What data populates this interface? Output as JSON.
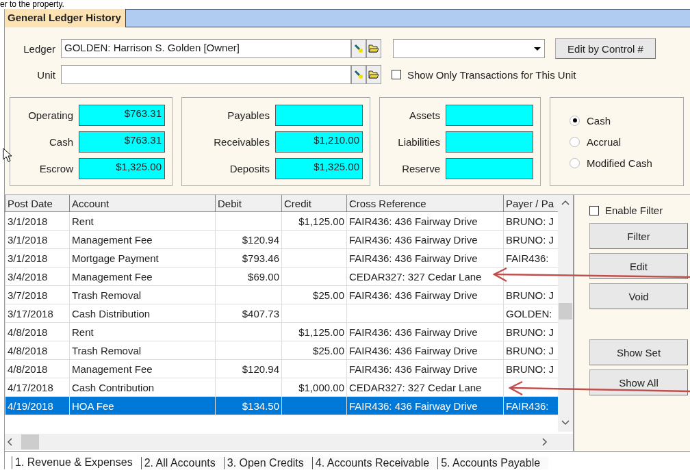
{
  "page_fragment": "er to the property.",
  "window": {
    "title": "General Ledger History"
  },
  "ledger": {
    "label": "Ledger",
    "value": "GOLDEN: Harrison S. Golden [Owner]"
  },
  "unit": {
    "label": "Unit"
  },
  "edit_by_control_button": "Edit by Control #",
  "unit_only_checkbox": {
    "label": "Show Only Transactions for This Unit",
    "checked": false
  },
  "balance_groups": [
    {
      "fields": [
        {
          "label": "Operating",
          "value": "$763.31"
        },
        {
          "label": "Cash",
          "value": "$763.31"
        },
        {
          "label": "Escrow",
          "value": "$1,325.00"
        }
      ]
    },
    {
      "fields": [
        {
          "label": "Payables"
        },
        {
          "label": "Receivables",
          "value": "$1,210.00"
        },
        {
          "label": "Deposits",
          "value": "$1,325.00"
        }
      ]
    },
    {
      "fields": [
        {
          "label": "Assets"
        },
        {
          "label": "Liabilities"
        },
        {
          "label": "Reserve"
        }
      ]
    }
  ],
  "basis_options": [
    {
      "label": "Cash",
      "selected": true
    },
    {
      "label": "Accrual",
      "selected": false
    },
    {
      "label": "Modified Cash",
      "selected": false
    }
  ],
  "table": {
    "columns": [
      "Post Date",
      "Account",
      "Debit",
      "Credit",
      "Cross Reference",
      "Payer / Pa"
    ],
    "rows": [
      {
        "post_date": "3/1/2018",
        "account": "Rent",
        "credit": "$1,125.00",
        "cross_reference": "FAIR436: 436 Fairway Drive",
        "payer": "BRUNO: J",
        "selected": false
      },
      {
        "post_date": "3/1/2018",
        "account": "Management Fee",
        "debit": "$120.94",
        "cross_reference": "FAIR436: 436 Fairway Drive",
        "payer": "BRUNO: J",
        "selected": false
      },
      {
        "post_date": "3/1/2018",
        "account": "Mortgage Payment",
        "debit": "$793.46",
        "cross_reference": "FAIR436: 436 Fairway Drive",
        "payer": "FAIR436:",
        "selected": false
      },
      {
        "post_date": "3/4/2018",
        "account": "Management Fee",
        "debit": "$69.00",
        "cross_reference": "CEDAR327: 327 Cedar Lane",
        "selected": false
      },
      {
        "post_date": "3/7/2018",
        "account": "Trash Removal",
        "credit": "$25.00",
        "cross_reference": "FAIR436: 436 Fairway Drive",
        "payer": "BRUNO: J",
        "selected": false
      },
      {
        "post_date": "3/17/2018",
        "account": "Cash Distribution",
        "debit": "$407.73",
        "payer": "GOLDEN:",
        "selected": false
      },
      {
        "post_date": "4/8/2018",
        "account": "Rent",
        "credit": "$1,125.00",
        "cross_reference": "FAIR436: 436 Fairway Drive",
        "payer": "BRUNO: J",
        "selected": false
      },
      {
        "post_date": "4/8/2018",
        "account": "Trash Removal",
        "credit": "$25.00",
        "cross_reference": "FAIR436: 436 Fairway Drive",
        "payer": "BRUNO: J",
        "selected": false
      },
      {
        "post_date": "4/8/2018",
        "account": "Management Fee",
        "debit": "$120.94",
        "cross_reference": "FAIR436: 436 Fairway Drive",
        "payer": "BRUNO: J",
        "selected": false
      },
      {
        "post_date": "4/17/2018",
        "account": "Cash Contribution",
        "credit": "$1,000.00",
        "cross_reference": "CEDAR327: 327 Cedar Lane",
        "selected": false
      },
      {
        "post_date": "4/19/2018",
        "account": "HOA Fee",
        "debit": "$134.50",
        "cross_reference": "FAIR436: 436 Fairway Drive",
        "payer": "FAIR436:",
        "selected": true
      }
    ]
  },
  "filter": {
    "enable_filter": {
      "label": "Enable Filter",
      "checked": false
    },
    "buttons": [
      "Filter",
      "Edit",
      "Void"
    ],
    "set_buttons": [
      "Show Set",
      "Show All"
    ]
  },
  "bottom_tabs": [
    {
      "label": "1. Revenue & Expenses",
      "selected": true
    },
    {
      "label": "2. All Accounts",
      "selected": false
    },
    {
      "label": "3. Open Credits",
      "selected": false
    },
    {
      "label": "4. Accounts Receivable",
      "selected": false
    },
    {
      "label": "5. Accounts Payable",
      "selected": false
    }
  ]
}
